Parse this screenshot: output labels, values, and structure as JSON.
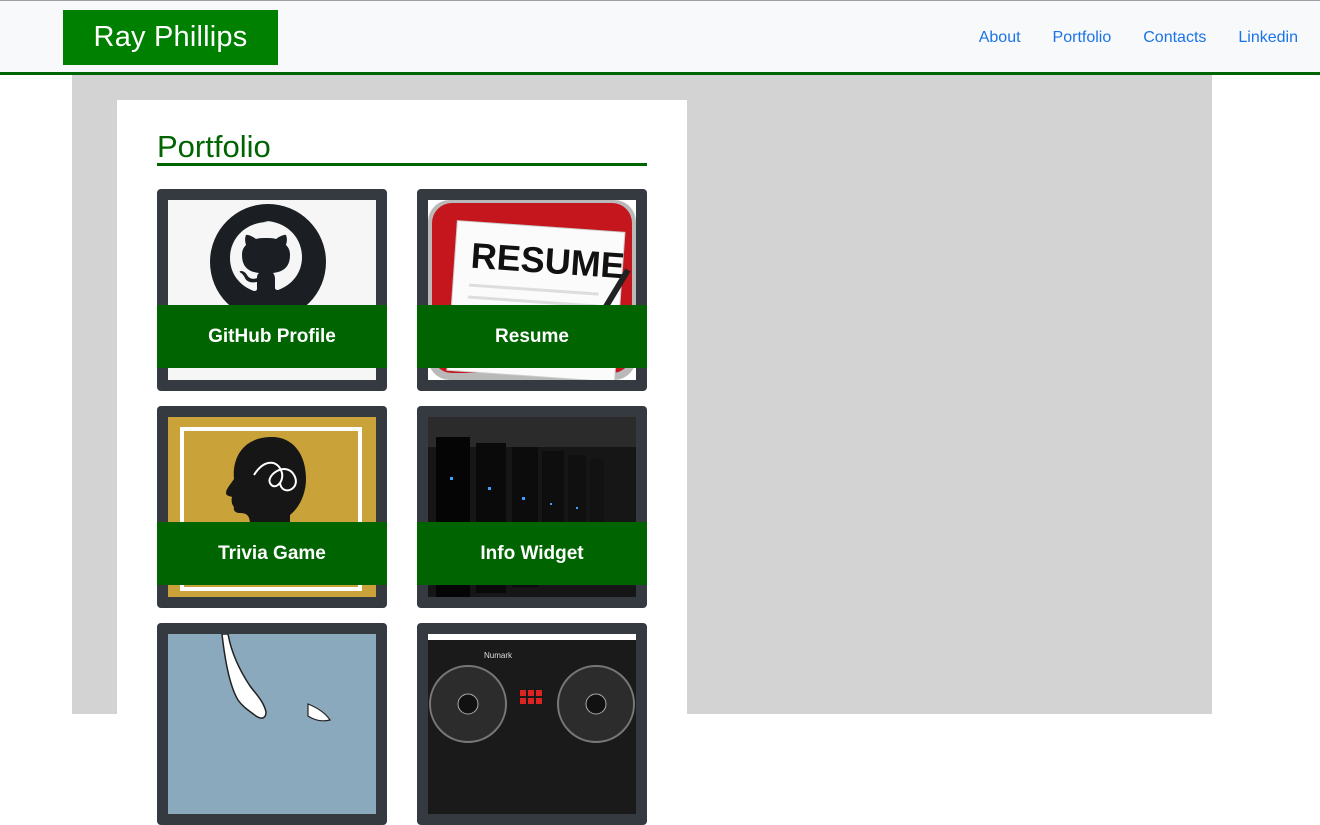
{
  "brand": {
    "name": "Ray Phillips"
  },
  "nav": {
    "links": [
      "About",
      "Portfolio",
      "Contacts",
      "Linkedin"
    ]
  },
  "portfolio": {
    "title": "Portfolio",
    "cards": [
      {
        "label": "GitHub Profile",
        "image": "github-octocat-logo"
      },
      {
        "label": "Resume",
        "image": "resume-document-icon",
        "image_text": "RESUME"
      },
      {
        "label": "Trivia Game",
        "image": "head-silhouette-trivia"
      },
      {
        "label": "Info Widget",
        "image": "server-racks-photo"
      },
      {
        "label": "",
        "image": "hand-reaching-illustration"
      },
      {
        "label": "",
        "image": "dj-controller-photo",
        "image_text": "Numark"
      }
    ]
  },
  "colors": {
    "brand_green": "#008000",
    "dark_green": "#006400",
    "card_dark": "#343a40",
    "page_gray": "#d3d3d3",
    "link_blue": "#1a73e8"
  }
}
